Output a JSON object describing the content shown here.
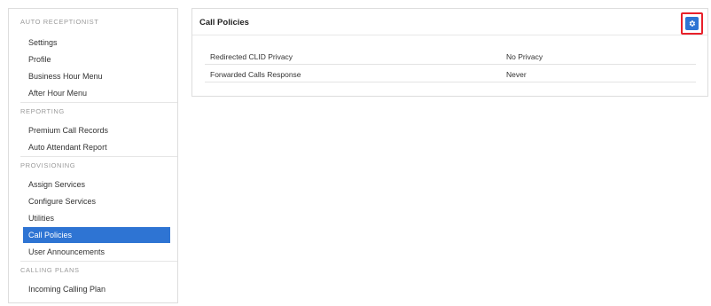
{
  "sidebar": {
    "sections": [
      {
        "header": "AUTO RECEPTIONIST",
        "items": [
          "Settings",
          "Profile",
          "Business Hour Menu",
          "After Hour Menu"
        ]
      },
      {
        "header": "REPORTING",
        "items": [
          "Premium Call Records",
          "Auto Attendant Report"
        ]
      },
      {
        "header": "PROVISIONING",
        "items": [
          "Assign Services",
          "Configure Services",
          "Utilities",
          "Call Policies",
          "User Announcements"
        ]
      },
      {
        "header": "CALLING PLANS",
        "items": [
          "Incoming Calling Plan"
        ]
      }
    ],
    "active_item": "Call Policies"
  },
  "panel": {
    "title": "Call Policies",
    "settings_icon": "gear-icon",
    "rows": [
      {
        "label": "Redirected CLID Privacy",
        "value": "No Privacy"
      },
      {
        "label": "Forwarded Calls Response",
        "value": "Never"
      }
    ]
  },
  "colors": {
    "accent": "#2e74d3",
    "highlight": "#e8202a",
    "border": "#dddddd"
  }
}
